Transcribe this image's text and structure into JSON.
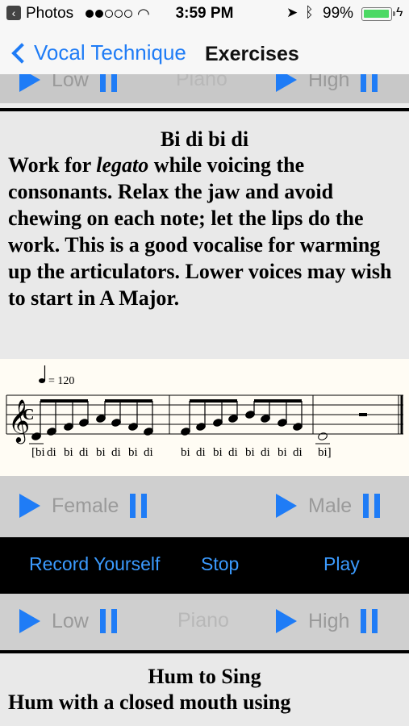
{
  "status": {
    "app_name": "Photos",
    "time": "3:59 PM",
    "battery_pct": "99%",
    "battery_level": 0.99
  },
  "nav": {
    "back_label": "Vocal Technique",
    "title": "Exercises"
  },
  "top_row": {
    "low_label": "Low",
    "piano_label": "Piano",
    "high_label": "High"
  },
  "exercise1": {
    "title": "Bi di bi di",
    "body_before": "Work for ",
    "body_em": "legato",
    "body_after": " while voicing the consonants.  Relax the jaw and avoid chewing on each note; let the lips do the work.  This is a good vocalise for warming up the articulators. Lower voices may wish to start in A Major.",
    "tempo": "= 120",
    "lyrics": [
      "[bi",
      "di",
      "bi",
      "di",
      "bi",
      "di",
      "bi",
      "di",
      "bi",
      "di",
      "bi",
      "di",
      "bi",
      "di",
      "bi",
      "di",
      "bi]"
    ],
    "female_label": "Female",
    "male_label": "Male"
  },
  "record": {
    "record_label": "Record Yourself",
    "stop_label": "Stop",
    "play_label": "Play"
  },
  "row3": {
    "low_label": "Low",
    "piano_label": "Piano",
    "high_label": "High"
  },
  "exercise2": {
    "title": "Hum to Sing",
    "body": "Hum with a closed mouth using"
  }
}
